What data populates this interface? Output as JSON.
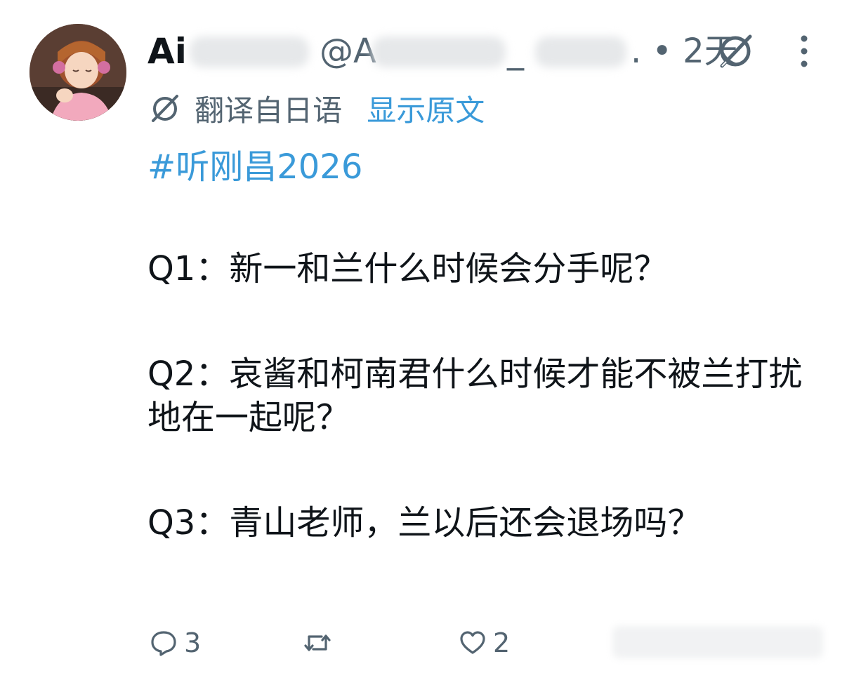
{
  "post": {
    "display_name_visible": "Ai",
    "handle_prefix": "@A",
    "handle_suffix": "_",
    "timestamp": ". • 2天",
    "translated_label": "翻译自日语",
    "show_original_label": "显示原文",
    "hashtag": "#听刚昌2026",
    "paragraphs": [
      "Q1：新一和兰什么时候会分手呢？",
      "Q2：哀酱和柯南君什么时候才能不被兰打扰地在一起呢？",
      "Q3：青山老师，兰以后还会退场吗？"
    ]
  },
  "actions": {
    "reply_count": "3",
    "retweet_count": "",
    "like_count": "2"
  },
  "icons": {
    "avatar": "avatar",
    "grok": "grok-icon",
    "more": "more-vertical-icon",
    "translate": "translate-icon",
    "reply": "reply-icon",
    "retweet": "retweet-icon",
    "like": "heart-icon"
  },
  "colors": {
    "link": "#3a9ad9",
    "secondary_text": "#536471",
    "primary_text": "#0f1419"
  }
}
